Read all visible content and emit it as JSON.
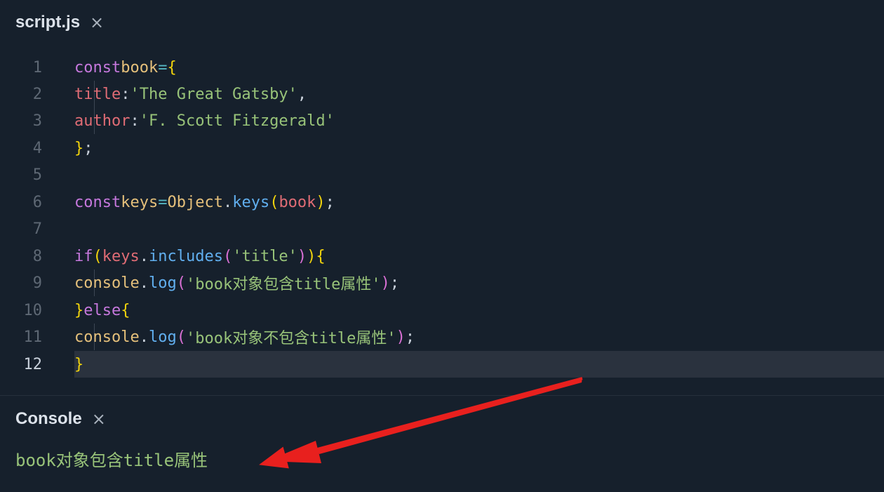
{
  "editor_tab": {
    "title": "script.js",
    "close": "×"
  },
  "code": {
    "line_numbers": [
      "1",
      "2",
      "3",
      "4",
      "5",
      "6",
      "7",
      "8",
      "9",
      "10",
      "11",
      "12"
    ],
    "l1": {
      "kw": "const",
      "name": "book",
      "eq": "=",
      "brace": "{"
    },
    "l2": {
      "prop": "title",
      "colon": ":",
      "str": "'The Great Gatsby'",
      "comma": ","
    },
    "l3": {
      "prop": "author",
      "colon": ":",
      "str": "'F. Scott Fitzgerald'"
    },
    "l4": {
      "brace": "}",
      "semi": ";"
    },
    "l6": {
      "kw": "const",
      "name": "keys",
      "eq": "=",
      "obj": "Object",
      "dot": ".",
      "fn": "keys",
      "lp": "(",
      "arg": "book",
      "rp": ")",
      "semi": ";"
    },
    "l8": {
      "kw": "if",
      "lp": "(",
      "obj": "keys",
      "dot": ".",
      "fn": "includes",
      "lp2": "(",
      "str": "'title'",
      "rp2": ")",
      "rp": ")",
      "brace": "{"
    },
    "l9": {
      "obj": "console",
      "dot": ".",
      "fn": "log",
      "lp": "(",
      "str": "'book对象包含title属性'",
      "rp": ")",
      "semi": ";"
    },
    "l10": {
      "close": "}",
      "kw": "else",
      "brace": "{"
    },
    "l11": {
      "obj": "console",
      "dot": ".",
      "fn": "log",
      "lp": "(",
      "str": "'book对象不包含title属性'",
      "rp": ")",
      "semi": ";"
    },
    "l12": {
      "brace": "}"
    }
  },
  "console_panel": {
    "title": "Console",
    "close": "×",
    "output": "book对象包含title属性"
  },
  "colors": {
    "background": "#16202c",
    "arrow": "#e8201e",
    "string": "#98c379",
    "keyword": "#c678dd"
  }
}
